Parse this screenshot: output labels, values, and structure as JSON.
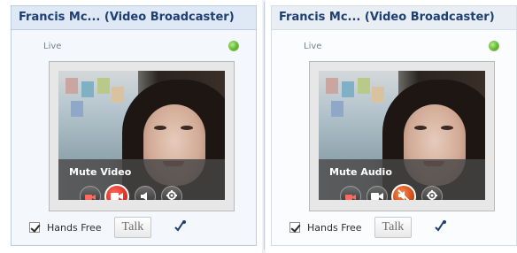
{
  "panels": [
    {
      "title": "Francis Mc... (Video Broadcaster)",
      "status": "Live",
      "tooltip": "Mute Video",
      "controls": [
        "camera-icon",
        "video-mute-icon",
        "speaker-icon",
        "settings-icon"
      ],
      "active_control": "video-mute-icon",
      "hands_free_label": "Hands Free",
      "hands_free_checked": true,
      "talk_label": "Talk"
    },
    {
      "title": "Francis Mc... (Video Broadcaster)",
      "status": "Live",
      "tooltip": "Mute Audio",
      "controls": [
        "camera-icon",
        "video-icon",
        "audio-mute-icon",
        "settings-icon"
      ],
      "active_control": "audio-mute-icon",
      "hands_free_label": "Hands Free",
      "hands_free_checked": true,
      "talk_label": "Talk"
    }
  ],
  "colors": {
    "title_text": "#1d3f72",
    "live_indicator": "#5bb52a",
    "active_button_video": "#d8271a",
    "active_button_audio": "#c9420f"
  }
}
